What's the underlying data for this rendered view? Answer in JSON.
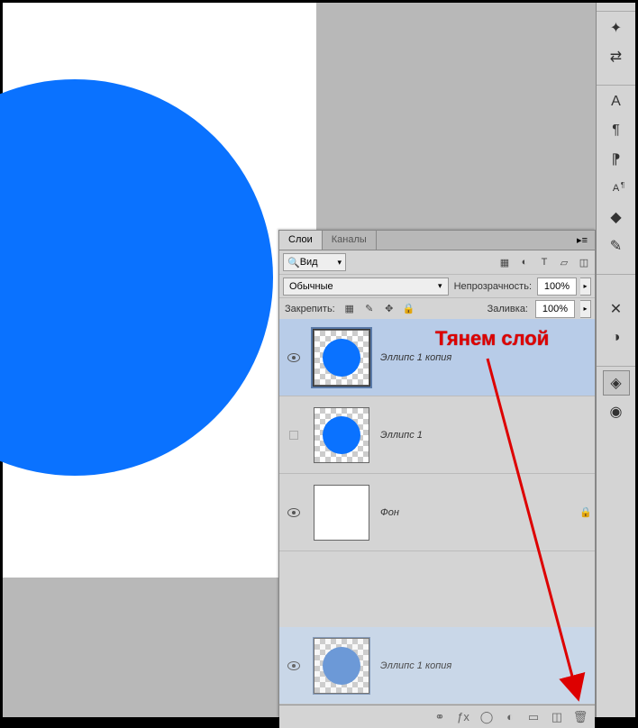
{
  "tabs": {
    "layers": "Слои",
    "channels": "Каналы"
  },
  "filter": {
    "kind": "Вид",
    "search_icon": "🔍"
  },
  "filter_icons": [
    "image",
    "adjust",
    "text",
    "shape",
    "smart"
  ],
  "blend": {
    "mode": "Обычные",
    "opacity_label": "Непрозрачность:",
    "opacity": "100%"
  },
  "lock": {
    "label": "Закрепить:",
    "fill_label": "Заливка:",
    "fill": "100%"
  },
  "layers": [
    {
      "name": "Эллипс 1 копия",
      "visible": true,
      "selected": true,
      "circle": true
    },
    {
      "name": "Эллипс 1",
      "visible": false,
      "selected": false,
      "circle": true
    },
    {
      "name": "Фон",
      "visible": true,
      "selected": false,
      "circle": false,
      "locked": true
    }
  ],
  "drag_layer": {
    "name": "Эллипс 1 копия"
  },
  "annotation": "Тянем слой",
  "right_tools": [
    "brush",
    "swap",
    "char",
    "para",
    "para2",
    "charA",
    "cube",
    "pen"
  ],
  "right_tools2": [
    "tools",
    "swatches"
  ],
  "right_tools3": [
    "layers",
    "styles"
  ]
}
